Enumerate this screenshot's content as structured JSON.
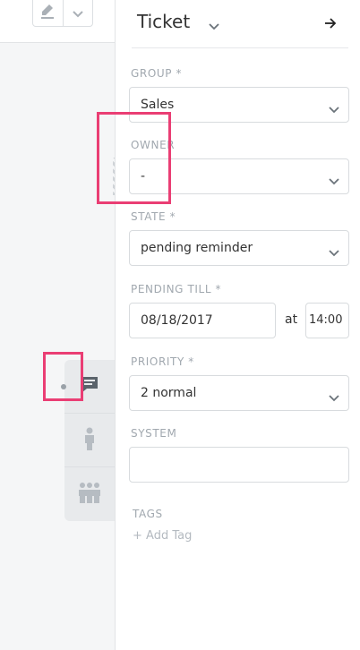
{
  "toolbar": {
    "edit_icon": "pencil-icon",
    "dropdown_icon": "chevron-down-icon"
  },
  "tabs": [
    {
      "name": "ticket",
      "icon": "chat-bubble-icon",
      "active": true
    },
    {
      "name": "customer",
      "icon": "person-icon",
      "active": false
    },
    {
      "name": "organization",
      "icon": "group-icon",
      "active": false
    }
  ],
  "sidebar": {
    "title": "Ticket",
    "fields": {
      "group": {
        "label": "GROUP *",
        "value": "Sales"
      },
      "owner": {
        "label": "OWNER",
        "value": "-"
      },
      "state": {
        "label": "STATE *",
        "value": "pending reminder"
      },
      "pending_till": {
        "label": "PENDING TILL *",
        "date": "08/18/2017",
        "at": "at",
        "time": "14:00"
      },
      "priority": {
        "label": "PRIORITY *",
        "value": "2 normal"
      },
      "system": {
        "label": "SYSTEM",
        "value": ""
      }
    },
    "tags": {
      "label": "TAGS",
      "add_label": "+ Add Tag"
    }
  },
  "colors": {
    "highlight": "#ea3e74",
    "label": "#a1a8af",
    "border": "#d8dbde"
  }
}
